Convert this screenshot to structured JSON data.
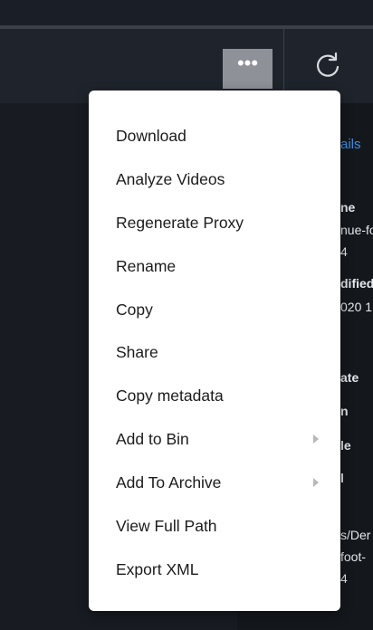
{
  "toolbar": {
    "more_label": "•••",
    "refresh_icon": "refresh-icon"
  },
  "details_peek": {
    "tab": "ails",
    "lines": [
      "ne",
      "nue-fo",
      "4",
      "dified",
      "020 1",
      "ate",
      "n",
      "le",
      "l",
      "s/Der",
      "foot-",
      "4"
    ]
  },
  "menu": {
    "items": [
      {
        "label": "Download",
        "submenu": false
      },
      {
        "label": "Analyze Videos",
        "submenu": false
      },
      {
        "label": "Regenerate Proxy",
        "submenu": false
      },
      {
        "label": "Rename",
        "submenu": false
      },
      {
        "label": "Copy",
        "submenu": false
      },
      {
        "label": "Share",
        "submenu": false
      },
      {
        "label": "Copy metadata",
        "submenu": false
      },
      {
        "label": "Add to Bin",
        "submenu": true
      },
      {
        "label": "Add To Archive",
        "submenu": true
      },
      {
        "label": "View Full Path",
        "submenu": false
      },
      {
        "label": "Export XML",
        "submenu": false
      }
    ]
  },
  "colors": {
    "background": "#1b1f26",
    "menu_bg": "#ffffff",
    "more_button_bg": "#8e9298",
    "accent_blue": "#3c8fe6"
  }
}
